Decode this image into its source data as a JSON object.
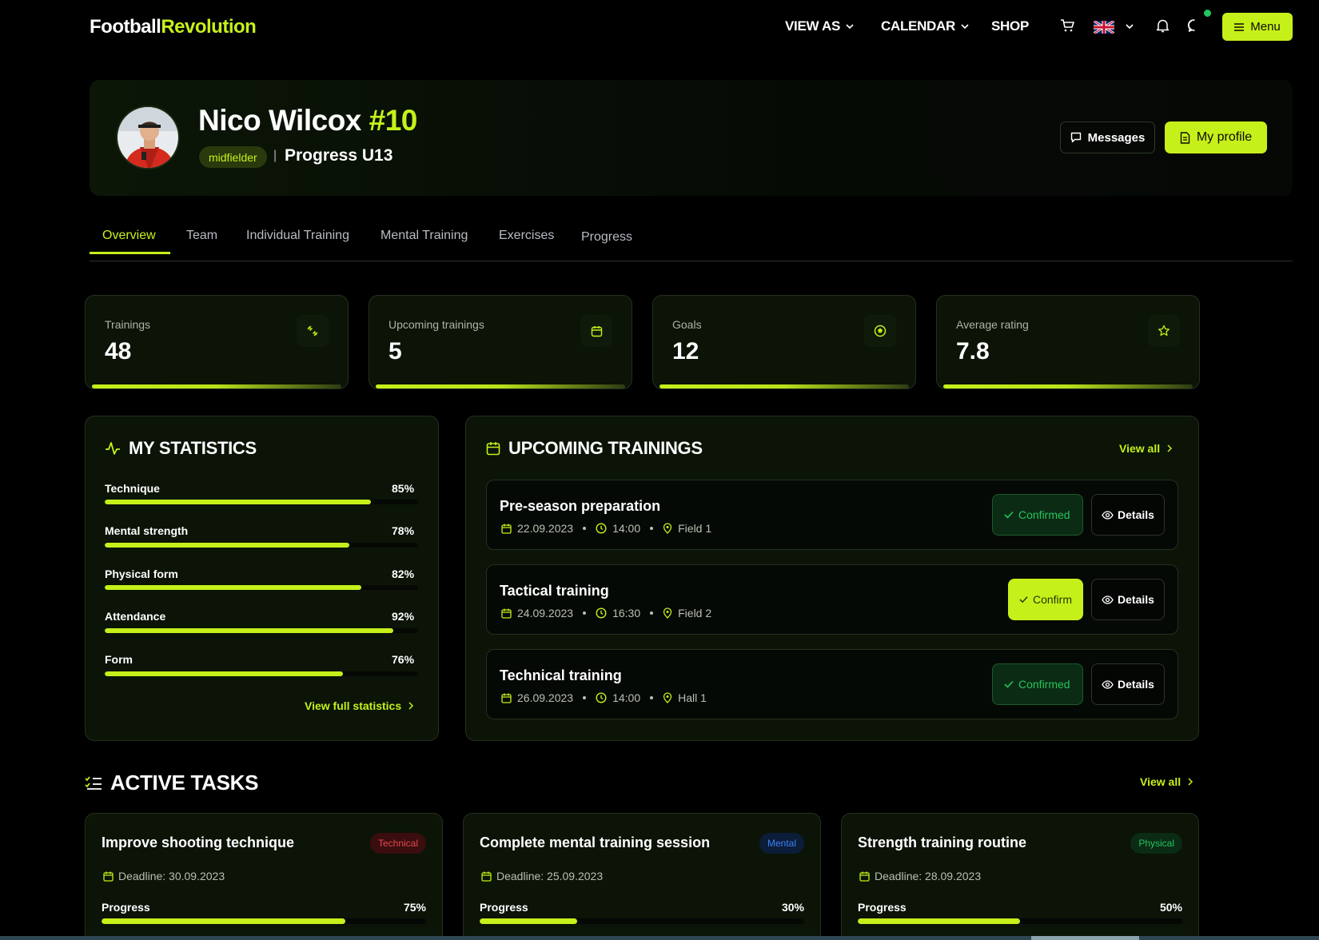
{
  "brand": {
    "part1": "Football",
    "part2": "Revolution"
  },
  "nav": {
    "view_as": "VIEW AS",
    "calendar": "CALENDAR",
    "shop": "SHOP",
    "menu": "Menu"
  },
  "player": {
    "name": "Nico Wilcox",
    "number": "#10",
    "position": "midfielder",
    "separator": "|",
    "team": "Progress U13"
  },
  "header_buttons": {
    "messages": "Messages",
    "profile": "My profile"
  },
  "tabs": [
    "Overview",
    "Team",
    "Individual Training",
    "Mental Training",
    "Exercises",
    "Progress"
  ],
  "stats": [
    {
      "label": "Trainings",
      "value": "48",
      "icon": "dumbbell-icon"
    },
    {
      "label": "Upcoming trainings",
      "value": "5",
      "icon": "calendar-icon"
    },
    {
      "label": "Goals",
      "value": "12",
      "icon": "ball-icon"
    },
    {
      "label": "Average rating",
      "value": "7.8",
      "icon": "star-icon"
    }
  ],
  "my_statistics": {
    "title": "MY STATISTICS",
    "items": [
      {
        "label": "Technique",
        "percent": "85%",
        "value": 85
      },
      {
        "label": "Mental strength",
        "percent": "78%",
        "value": 78
      },
      {
        "label": "Physical form",
        "percent": "82%",
        "value": 82
      },
      {
        "label": "Attendance",
        "percent": "92%",
        "value": 92
      },
      {
        "label": "Form",
        "percent": "76%",
        "value": 76
      }
    ],
    "link": "View full statistics"
  },
  "upcoming": {
    "title": "UPCOMING TRAININGS",
    "view_all": "View all",
    "items": [
      {
        "title": "Pre-season preparation",
        "date": "22.09.2023",
        "time": "14:00",
        "place": "Field 1",
        "status": "Confirmed",
        "details": "Details"
      },
      {
        "title": "Tactical training",
        "date": "24.09.2023",
        "time": "16:30",
        "place": "Field 2",
        "status": "Confirm",
        "details": "Details"
      },
      {
        "title": "Technical training",
        "date": "26.09.2023",
        "time": "14:00",
        "place": "Hall 1",
        "status": "Confirmed",
        "details": "Details"
      }
    ]
  },
  "tasks": {
    "title": "ACTIVE TASKS",
    "view_all": "View all",
    "items": [
      {
        "title": "Improve shooting technique",
        "tag": "Technical",
        "tag_color": "#e5484d",
        "deadline": "Deadline: 30.09.2023",
        "progress_label": "Progress",
        "percent": "75%",
        "value": 75
      },
      {
        "title": "Complete mental training session",
        "tag": "Mental",
        "tag_color": "#3b82f6",
        "deadline": "Deadline: 25.09.2023",
        "progress_label": "Progress",
        "percent": "30%",
        "value": 30
      },
      {
        "title": "Strength training routine",
        "tag": "Physical",
        "tag_color": "#22c55e",
        "deadline": "Deadline: 28.09.2023",
        "progress_label": "Progress",
        "percent": "50%",
        "value": 50
      }
    ]
  },
  "colors": {
    "accent": "#c6f01a",
    "background": "#000000",
    "card": "#0b1407",
    "confirmed": "#28c35c"
  }
}
